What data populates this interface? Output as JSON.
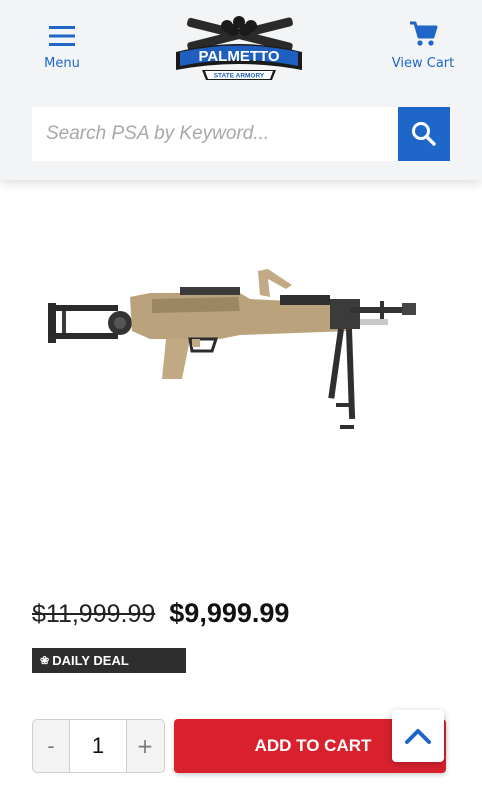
{
  "header": {
    "menu_label": "Menu",
    "cart_label": "View Cart",
    "logo_text": "PALMETTO",
    "logo_subtext": "STATE ARMORY",
    "menu_icon": "hamburger-icon",
    "cart_icon": "shopping-cart-icon"
  },
  "search": {
    "placeholder": "Search PSA by Keyword...",
    "value": "",
    "icon": "search-icon"
  },
  "product": {
    "image": "machine-gun-product-image",
    "old_price": "$11,999.99",
    "price": "$9,999.99",
    "badge": "DAILY DEAL",
    "quantity": "1",
    "decrement_label": "-",
    "increment_label": "+",
    "add_to_cart_label": "ADD TO CART"
  },
  "scroll_top": {
    "icon": "chevron-up-icon"
  },
  "colors": {
    "accent_blue": "#1e66c8",
    "cart_red": "#d9212e",
    "badge_dark": "#2e2e2e",
    "header_bg": "#f3f4f6"
  }
}
